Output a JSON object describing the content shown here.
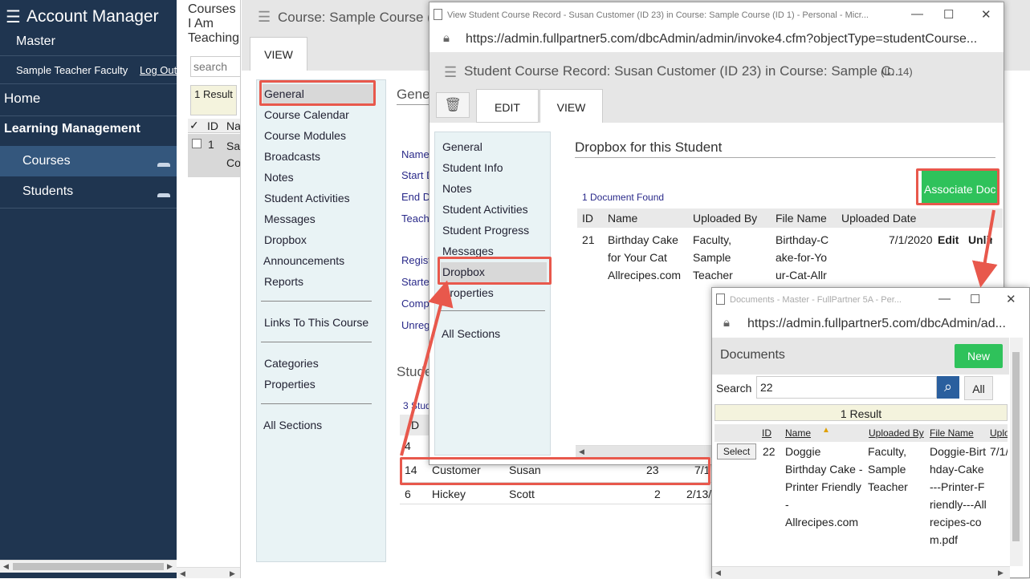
{
  "sidebar": {
    "app_title": "Account Manager",
    "account": "Master",
    "user": "Sample Teacher Faculty",
    "logout": "Log Out",
    "home": "Home",
    "section": "Learning Management",
    "items": [
      {
        "label": "Courses"
      },
      {
        "label": "Students"
      }
    ]
  },
  "list_panel": {
    "heading": "Courses I Am Teaching",
    "search_placeholder": "search",
    "result_count": "1 Result",
    "col_check": "✓",
    "col_id": "ID",
    "col_name": "Na",
    "row_id": "1",
    "row_name": "Sa Co"
  },
  "course": {
    "title": "Course: Sample Course (ID",
    "tab_view": "VIEW",
    "nav": [
      "General",
      "Course Calendar",
      "Course Modules",
      "Broadcasts",
      "Notes",
      "Student Activities",
      "Messages",
      "Dropbox",
      "Announcements",
      "Reports",
      "Links To This Course",
      "Categories",
      "Properties",
      "All Sections"
    ],
    "section_heading": "Gene",
    "fields": [
      "Name",
      "Start D",
      "End D",
      "Teach",
      "Regist",
      "Starte",
      "Comp",
      "Unreg"
    ],
    "students_heading": "Stude",
    "students_count": "3 Stud",
    "students_id_col": "D",
    "students_rows": [
      {
        "id": "4",
        "last": "",
        "first": "",
        "num": "",
        "date": ""
      },
      {
        "id": "14",
        "last": "Customer",
        "first": "Susan",
        "num": "23",
        "date": "7/1"
      },
      {
        "id": "6",
        "last": "Hickey",
        "first": "Scott",
        "num": "2",
        "date": "2/13/"
      }
    ]
  },
  "record_window": {
    "title": "View Student Course Record - Susan Customer (ID 23) in Course: Sample Course (ID 1) - Personal - Micr...",
    "url": "https://admin.fullpartner5.com/dbcAdmin/admin/invoke4.cfm?objectType=studentCourse...",
    "header": "Student Course Record: Susan Customer (ID 23) in Course: Sample C...",
    "header_id": "(ID 14)",
    "tab_edit": "EDIT",
    "tab_view": "VIEW",
    "nav": [
      "General",
      "Student Info",
      "Notes",
      "Student Activities",
      "Student Progress",
      "Messages",
      "Dropbox",
      "Properties",
      "All Sections"
    ],
    "dropbox_heading": "Dropbox for this Student",
    "associate_button": "Associate Doc",
    "found_text": "1 Document Found",
    "columns": [
      "ID",
      "Name",
      "Uploaded By",
      "File Name",
      "Uploaded Date"
    ],
    "row": {
      "id": "21",
      "name": "Birthday Cake for Your Cat Allrecipes.com",
      "uploaded_by": "Faculty, Sample Teacher",
      "file_name": "Birthday-Cake-for-Your-Cat-Allrec",
      "date": "7/1/2020",
      "edit": "Edit",
      "unlink": "Unlink"
    }
  },
  "docs_window": {
    "title": "Documents - Master - FullPartner 5A - Per...",
    "url": "https://admin.fullpartner5.com/dbcAdmin/ad...",
    "heading": "Documents",
    "new_button": "New",
    "search_label": "Search",
    "search_value": "22",
    "all_button": "All",
    "result_count": "1 Result",
    "columns": [
      "ID",
      "Name",
      "Uploaded By",
      "File Name",
      "Uplo"
    ],
    "row": {
      "select": "Select",
      "id": "22",
      "name": "Doggie Birthday Cake - Printer Friendly - Allrecipes.com",
      "uploaded_by": "Faculty, Sample Teacher",
      "file_name": "Doggie-Birthday-Cake---Printer-Friendly---Allrecipes-com.pdf",
      "date": "7/1/"
    }
  },
  "colors": {
    "sidebar": "#1f3550",
    "active": "#34577d",
    "highlight": "#e8584c",
    "green": "#2fc25b",
    "link": "#2a2a8a"
  }
}
